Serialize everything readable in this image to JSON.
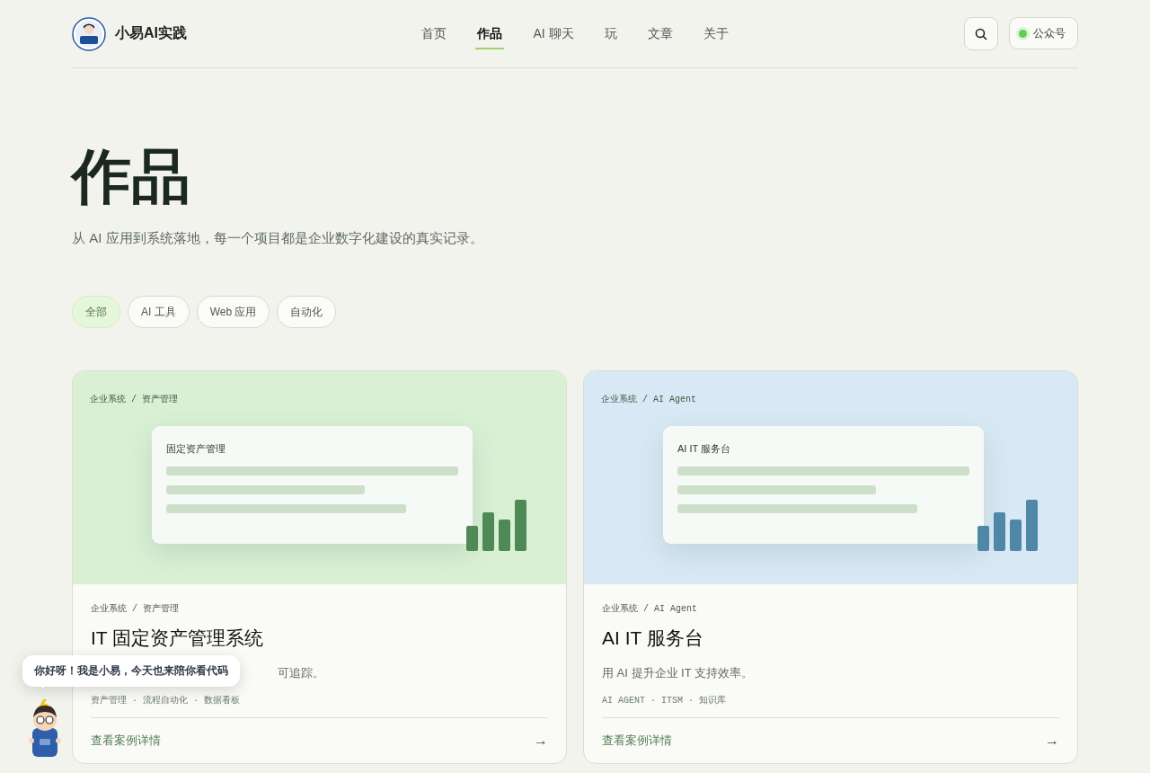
{
  "header": {
    "brand": "小易AI实践",
    "nav": [
      {
        "label": "首页",
        "selected": false
      },
      {
        "label": "作品",
        "selected": true
      },
      {
        "label": "AI 聊天",
        "selected": false
      },
      {
        "label": "玩",
        "selected": false
      },
      {
        "label": "文章",
        "selected": false
      },
      {
        "label": "关于",
        "selected": false
      }
    ],
    "wechat": {
      "label": "公众号",
      "online": true
    }
  },
  "page": {
    "title": "作品",
    "subtitle": "从 AI 应用到系统落地，每一个项目都是企业数字化建设的真实记录。"
  },
  "filters": [
    {
      "label": "全部",
      "selected": true
    },
    {
      "label": "AI 工具",
      "selected": false
    },
    {
      "label": "Web 应用",
      "selected": false
    },
    {
      "label": "自动化",
      "selected": false
    }
  ],
  "cards": [
    {
      "color": "#4f8a56",
      "crumb": "企业系统 / 资产管理",
      "mock_title": "固定资产管理",
      "crumb2": "企业系统 / 资产管理",
      "title": "IT 固定资产管理系统",
      "description": "可追踪。",
      "description_covered": true,
      "tags": "资产管理 · 流程自动化 · 数据看板",
      "link": "查看案例详情",
      "arrow": "→"
    },
    {
      "color": "#4f88a6",
      "crumb": "企业系统 / AI Agent",
      "mock_title": "AI IT 服务台",
      "crumb2": "企业系统 / AI Agent",
      "title": "AI IT 服务台",
      "description": "用 AI 提升企业 IT 支持效率。",
      "tags": "AI AGENT · ITSM · 知识库",
      "link": "查看案例详情",
      "arrow": "→"
    }
  ],
  "assistant": {
    "greeting": "你好呀！我是小易，今天也来陪你看代码"
  }
}
